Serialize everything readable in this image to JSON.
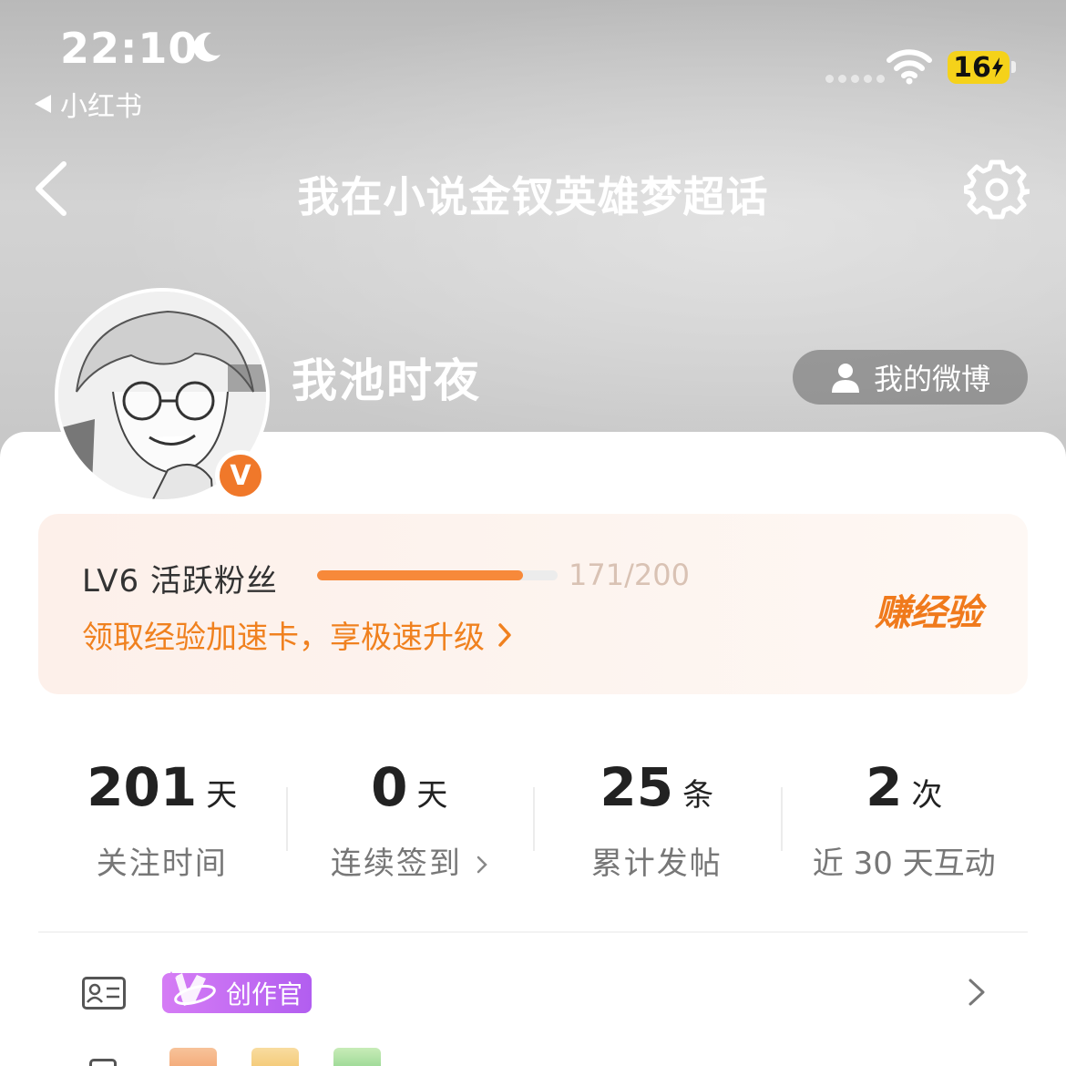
{
  "status_bar": {
    "time": "22:10",
    "back_app": "小红书",
    "battery": "16"
  },
  "nav": {
    "title": "我在小说金钗英雄梦超话"
  },
  "profile": {
    "username": "我池时夜",
    "verified_badge": "V",
    "weibo_button": "我的微博"
  },
  "level": {
    "label": "LV6 活跃粉丝",
    "progress_current": 171,
    "progress_max": 200,
    "progress_text": "171/200",
    "promo_text": "领取经验加速卡，享极速升级",
    "earn_button": "赚经验"
  },
  "stats": [
    {
      "value": "201",
      "unit": "天",
      "label": "关注时间",
      "chevron": false
    },
    {
      "value": "0",
      "unit": "天",
      "label": "连续签到",
      "chevron": true
    },
    {
      "value": "25",
      "unit": "条",
      "label": "累计发帖",
      "chevron": false
    },
    {
      "value": "2",
      "unit": "次",
      "label": "近 30 天互动",
      "chevron": false
    }
  ],
  "badges": {
    "creator": "创作官"
  },
  "colors": {
    "accent": "#f7893a",
    "promo": "#f0811f",
    "verified": "#f0782a",
    "creator": "#b25ef0"
  },
  "icons": [
    "moon-icon",
    "wifi-icon",
    "back-icon",
    "gear-icon",
    "user-icon",
    "chevron-right-icon",
    "id-card-icon"
  ]
}
